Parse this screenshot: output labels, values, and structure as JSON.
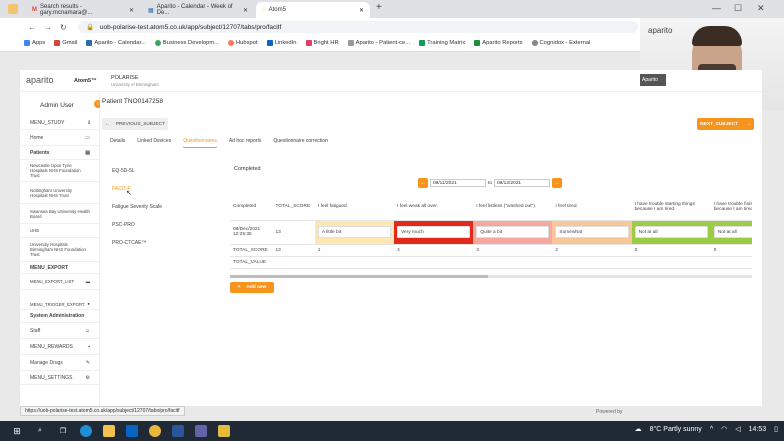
{
  "browser": {
    "tabs": [
      {
        "label": "Search results - gary.mcnamara@..."
      },
      {
        "label": "Aparito - Calendar - Week of De..."
      },
      {
        "label": "Atom5"
      }
    ],
    "new_tab": "+",
    "url": "uob-polarise-test.atom5.co.uk/app/subject/12707/tabs/pro/facitf",
    "bookmarks": [
      "Apps",
      "Gmail",
      "Aparito - Calendar...",
      "Business Developm...",
      "Hubspot",
      "LinkedIn",
      "Bright HR",
      "Aparito - Patient-ce...",
      "Training Matrix",
      "Aparito Reports",
      "Cognidox - External"
    ],
    "status_url": "https://uob-polarise-test.atom5.co.uk/app/subject/12707/tabs/pro/facitf"
  },
  "webcam": {
    "logo": "aparito"
  },
  "app": {
    "logo": "aparito",
    "product": "Atom5™",
    "study_name": "POLARISE",
    "study_org": "University of Birmingham",
    "org_badge": "Aparito",
    "user": "Admin User",
    "menu_study": "MENU_STUDY",
    "home": "Home",
    "patients": "Patients",
    "sites": [
      "Newcastle Upon Tyne Hospitals NHS Foundation Trust",
      "Nottingham University Hospitals NHS Trust",
      "Swansea Bay University Health Board",
      "UHB",
      "University Hospitals Birmingham NHS Foundation Trust"
    ],
    "menu_export": "MENU_EXPORT",
    "menu_export_list": "MENU_EXPORT_LIST",
    "menu_trigger_export": "MENU_TRIGGER_EXPORT",
    "system_admin": "System Administration",
    "staff": "Staff",
    "menu_rewards": "MENU_REWARDS",
    "manage_drugs": "Manage Drugs",
    "menu_settings": "MENU_SETTINGS"
  },
  "patient": {
    "title": "Patient TNO0147258",
    "prev_btn": "PREVIOUS_SUBJECT",
    "next_btn": "NEXT_SUBJECT",
    "tabs": [
      "Details",
      "Linked Devices",
      "Questionnaires",
      "Ad hoc reports",
      "Questionnaire correction"
    ],
    "questionnaires": [
      "EQ-5D-5L",
      "FACIT-F",
      "Fatigue Severity Scale",
      "PSC-PRO",
      "PRO-CTCAE™"
    ],
    "panel_title": "Completed",
    "date_from": "08/11/2021",
    "date_to_label": "to",
    "date_to": "08/12/2021",
    "columns": [
      "Completed",
      "TOTAL_SCORE",
      "I feel fatigued.",
      "I feel weak all over.",
      "I feel listless (\"washed out\").",
      "I feel tired.",
      "I have trouble starting things because I am tired.",
      "I have trouble finishing thi... because I am tired."
    ],
    "row": {
      "date": "08/Dec/2021 12:25:36",
      "total": "13",
      "answers": [
        "A little bit",
        "Very much",
        "Quite a bit",
        "Somewhat",
        "Not at all",
        "Not at all"
      ]
    },
    "total_score_label": "TOTAL_SCORE",
    "total_score_values": [
      "13",
      "1",
      "4",
      "3",
      "2",
      "0",
      "0"
    ],
    "total_value_label": "TOTAL_VALUE",
    "add_new": "Add new",
    "powered_by": "Powered by"
  },
  "colors": {
    "accent": "#f7941d",
    "answers": [
      "#fde7b3",
      "#e02a1b",
      "#f5a8a0",
      "#f9c59a",
      "#9ccc45",
      "#9ccc45"
    ]
  },
  "taskbar": {
    "weather": "8°C  Partly sunny",
    "time": "14:53"
  }
}
